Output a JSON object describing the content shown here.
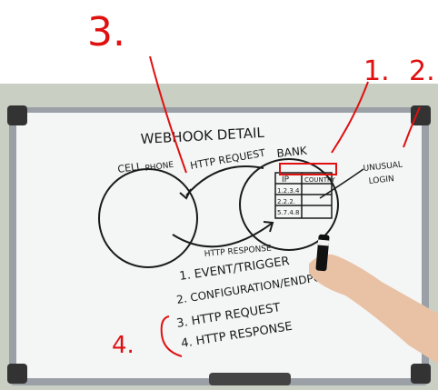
{
  "annotations": {
    "n1": "1.",
    "n2": "2.",
    "n3": "3.",
    "n4": "4.",
    "red_color": "#e01010"
  },
  "board": {
    "title": "WEBHOOK DETAIL",
    "left_label_line1": "CELL",
    "left_label_line2": "PHONE",
    "right_label": "BANK",
    "arrow_top_label": "HTTP REQUEST",
    "arrow_bottom_label": "HTTP RESPONSE",
    "side_note_line1": "UNUSUAL",
    "side_note_line2": "LOGIN",
    "table": {
      "col_ip": "IP",
      "col_country": "COUNTRY",
      "rows": [
        "1.2.3.4",
        "2.2.2.",
        "5.7.4.8"
      ]
    },
    "list": [
      "1. EVENT/TRIGGER",
      "2. CONFIGURATION/ENDPOINT",
      "3. HTTP REQUEST",
      "4. HTTP RESPONSE"
    ]
  },
  "colors": {
    "wall": "#c9cfc2",
    "board_white": "#f4f6f6",
    "frame": "#9aa0a6",
    "marker_black": "#1a1a1a"
  }
}
